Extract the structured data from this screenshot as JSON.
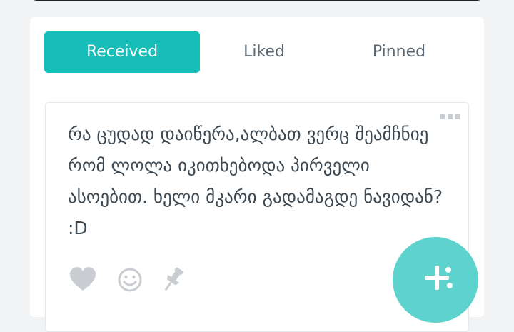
{
  "tabs": [
    {
      "label": "Received",
      "active": true
    },
    {
      "label": "Liked",
      "active": false
    },
    {
      "label": "Pinned",
      "active": false
    }
  ],
  "message": {
    "text": "რა ცუდად დაიწერა,ალბათ ვერც შეამჩნიე რომ ლოლა იკითხებოდა პირველი ასოებით. ხელი მკარი გადამაგდე ნავიდან? :D"
  },
  "icons": {
    "menu": "more-dots-icon",
    "like": "heart-icon",
    "emoji": "smiley-icon",
    "pin": "pushpin-icon",
    "fab": "plus-share-icon"
  },
  "colors": {
    "accent": "#17bdb8",
    "fab": "#5ed3ce",
    "icon": "#c9cdd1",
    "text": "#3d4952"
  }
}
